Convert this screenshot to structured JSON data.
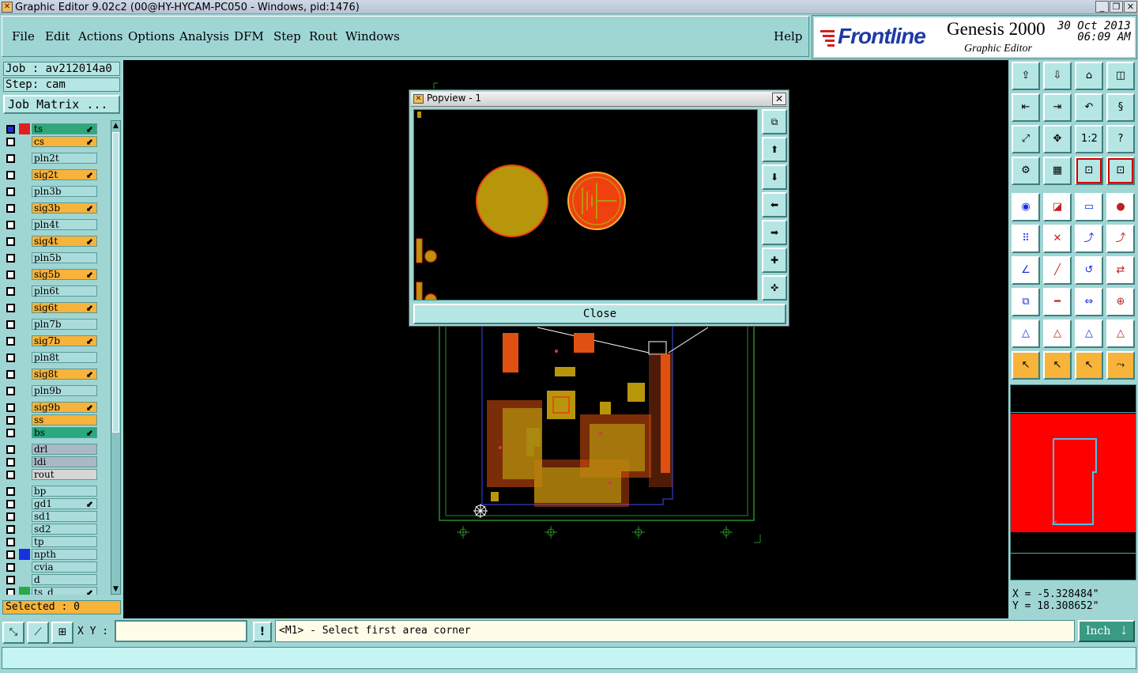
{
  "window": {
    "title": "Graphic Editor 9.02c2 (00@HY-HYCAM-PC050 - Windows, pid:1476)"
  },
  "menu": {
    "items": [
      "File",
      "Edit",
      "Actions",
      "Options",
      "Analysis",
      "DFM",
      "Step",
      "Rout",
      "Windows"
    ],
    "help": "Help"
  },
  "brand": {
    "logo": "Frontline",
    "product": "Genesis 2000",
    "date": "30 Oct 2013",
    "time": "06:09 AM",
    "subtitle": "Graphic Editor"
  },
  "job": {
    "job_label": "Job : av212014a0",
    "step_label": "Step: cam",
    "matrix_button": "Job Matrix ..."
  },
  "layers": [
    {
      "name": "ts",
      "kind": "sel",
      "color": "#e02020",
      "mark": "⬋"
    },
    {
      "name": "cs",
      "kind": "sig",
      "color": "",
      "mark": "⬋"
    },
    {
      "name": "pln2t",
      "kind": "pln",
      "color": "",
      "mark": ""
    },
    {
      "name": "sig2t",
      "kind": "sig",
      "color": "",
      "mark": "⬋"
    },
    {
      "name": "pln3b",
      "kind": "pln",
      "color": "",
      "mark": ""
    },
    {
      "name": "sig3b",
      "kind": "sig",
      "color": "",
      "mark": "⬋"
    },
    {
      "name": "pln4t",
      "kind": "pln",
      "color": "",
      "mark": ""
    },
    {
      "name": "sig4t",
      "kind": "sig",
      "color": "",
      "mark": "⬋"
    },
    {
      "name": "pln5b",
      "kind": "pln",
      "color": "",
      "mark": ""
    },
    {
      "name": "sig5b",
      "kind": "sig",
      "color": "",
      "mark": "⬋"
    },
    {
      "name": "pln6t",
      "kind": "pln",
      "color": "",
      "mark": ""
    },
    {
      "name": "sig6t",
      "kind": "sig",
      "color": "",
      "mark": "⬋"
    },
    {
      "name": "pln7b",
      "kind": "pln",
      "color": "",
      "mark": ""
    },
    {
      "name": "sig7b",
      "kind": "sig",
      "color": "",
      "mark": "⬋"
    },
    {
      "name": "pln8t",
      "kind": "pln",
      "color": "",
      "mark": ""
    },
    {
      "name": "sig8t",
      "kind": "sig",
      "color": "",
      "mark": "⬋"
    },
    {
      "name": "pln9b",
      "kind": "pln",
      "color": "",
      "mark": ""
    },
    {
      "name": "sig9b",
      "kind": "sig",
      "color": "",
      "mark": "⬋"
    },
    {
      "name": "ss",
      "kind": "sig",
      "color": "",
      "mark": ""
    },
    {
      "name": "bs",
      "kind": "solder",
      "color": "",
      "mark": "⬋"
    },
    {
      "name": "drl",
      "kind": "drill",
      "color": "",
      "mark": ""
    },
    {
      "name": "ldi",
      "kind": "drill",
      "color": "",
      "mark": ""
    },
    {
      "name": "rout",
      "kind": "rout",
      "color": "",
      "mark": ""
    },
    {
      "name": "bp",
      "kind": "doc",
      "color": "",
      "mark": ""
    },
    {
      "name": "gd1",
      "kind": "doc",
      "color": "",
      "mark": "⬋"
    },
    {
      "name": "sd1",
      "kind": "doc",
      "color": "",
      "mark": ""
    },
    {
      "name": "sd2",
      "kind": "doc",
      "color": "",
      "mark": ""
    },
    {
      "name": "tp",
      "kind": "doc",
      "color": "",
      "mark": ""
    },
    {
      "name": "npth",
      "kind": "doc",
      "color": "#1a2fe0",
      "mark": ""
    },
    {
      "name": "cvia",
      "kind": "doc",
      "color": "",
      "mark": ""
    },
    {
      "name": "d",
      "kind": "doc",
      "color": "",
      "mark": ""
    },
    {
      "name": "ts_d",
      "kind": "doc",
      "color": "#2aa84a",
      "mark": "⬋"
    }
  ],
  "selected": "Selected : 0",
  "coords": {
    "x": "X = -5.328484\"",
    "y": "Y = 18.308652\""
  },
  "bottom": {
    "xy_label": "X Y :",
    "xy_value": "",
    "exclaim": "!",
    "prompt": "<M1> - Select first area corner",
    "units": "Inch"
  },
  "popview": {
    "title": "Popview - 1",
    "close_button": "Close"
  },
  "colors": {
    "panel": "#9fd6d4",
    "signal": "#f7b33a",
    "copper": "#b8960c",
    "pad": "#f04010"
  },
  "tools": [
    "layer-up-icon",
    "layer-down-icon",
    "home-icon",
    "split-view-icon",
    "pan-left-icon",
    "pan-right-icon",
    "pan-back-icon",
    "pan-s-icon",
    "zoom-fit-icon",
    "zoom-center-icon",
    "one-to-two-icon",
    "help-query-icon",
    "settings-icon",
    "grid-icon",
    "snap-red-icon",
    "snap-red-2-icon",
    "select-circle-icon",
    "measure-icon",
    "ruler-icon",
    "pad-icon",
    "connect-icon",
    "cross-icon",
    "move-icon",
    "move-red-icon",
    "angle-icon",
    "line-icon",
    "rotate-icon",
    "mirror-icon",
    "copy-icon",
    "minus-icon",
    "resize-icon",
    "group-icon",
    "triangle-icon",
    "triangle-2-icon",
    "triangle-3-icon",
    "triangle-4-icon",
    "pointer-icon",
    "pointer-box-icon",
    "pointer-red-icon",
    "route-icon"
  ]
}
